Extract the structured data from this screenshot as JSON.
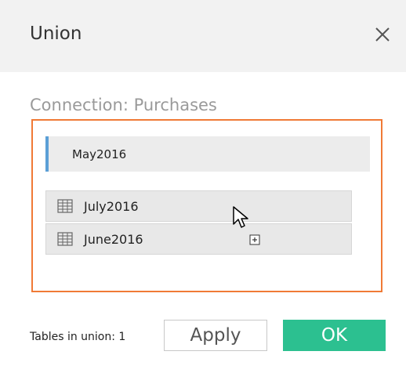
{
  "dialog": {
    "title": "Union",
    "close_icon": "close-icon"
  },
  "connection": {
    "label": "Connection: Purchases"
  },
  "union_tables": [
    {
      "label": "May2016"
    }
  ],
  "dragged_tables": [
    {
      "label": "July2016",
      "icon": "table-icon"
    },
    {
      "label": "June2016",
      "icon": "table-icon"
    }
  ],
  "footer": {
    "tables_in_union": "Tables in union: 1",
    "apply_label": "Apply",
    "ok_label": "OK"
  },
  "colors": {
    "drop_zone_border": "#f07a36",
    "union_accent": "#5b9fd6",
    "ok_button": "#2cc090"
  }
}
